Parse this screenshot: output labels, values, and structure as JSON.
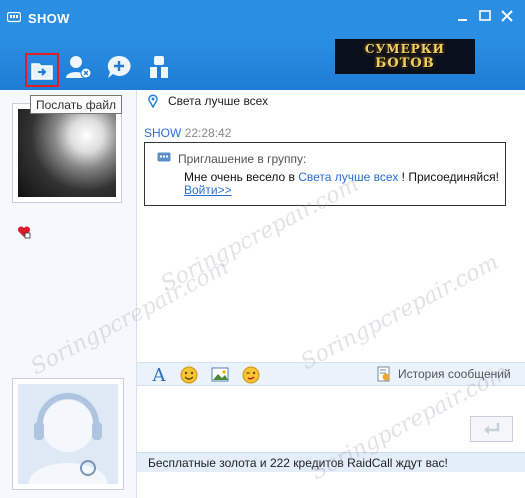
{
  "window": {
    "title": "SHOW"
  },
  "toolbar": {
    "send_file_tooltip": "Послать файл",
    "banner_line1": "СУМЕРКИ",
    "banner_line2": "БОТОВ"
  },
  "channel": {
    "name": "Света лучше всех"
  },
  "message": {
    "sender": "SHOW",
    "time": "22:28:42",
    "invite_title": "Приглашение в группу:",
    "invite_text_before": "Мне очень весело в ",
    "invite_group_link": "Света лучше всех",
    "invite_text_after": " ! Присоединяйся!",
    "invite_join": "Войти>>"
  },
  "input_toolbar": {
    "history_label": "История сообщений"
  },
  "footer": {
    "promo": "Бесплатные золота и 222 кредитов RaidCall ждут вас!"
  },
  "watermark": "Soringpcrepair.com"
}
